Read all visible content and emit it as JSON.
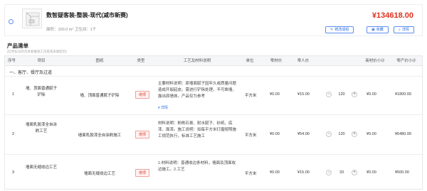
{
  "package": {
    "title": "数智疑客装-整装-现代(减市新赛)",
    "area_line": "面积：100.0 m²   卫生间：1个",
    "price": "¥134618.00",
    "buttons": {
      "edit": "修改成组",
      "collect": "收藏",
      "detail": "详情"
    }
  },
  "list": {
    "title": "产品清单",
    "subtitle": "(红色标记的为本套餐施工内容或未确定的)"
  },
  "table": {
    "headers": [
      "序号",
      "项目",
      "图纸",
      "类型",
      "工艺及材料说明",
      "单位",
      "零材价",
      "零人价",
      "",
      "商材价小计",
      "零产价小计"
    ],
    "group_label": "一、客厅、餐厅及过道",
    "detail_link": "详情",
    "rows": [
      {
        "no": "1",
        "item": "墙、顶面普通腻子铲除",
        "name": "墙、顶面普通腻子铲除",
        "type": "增项",
        "desc": "主要材料说明：原墙面腻子因年久或质量问题造成开裂起皮。需进行铲除处理，不可凿墙，露出原墙体。产品仅为参考",
        "unit": "平方米",
        "mat_price": "¥0.00",
        "labor_price": "¥15.00",
        "qty": "120",
        "subtotal_mat": "¥0.00",
        "subtotal_labor": "¥1800.00"
      },
      {
        "no": "2",
        "item": "墙面乳胶漆全自涂刷工艺",
        "name": "墙面乳胶漆全自涂刷施工",
        "type": "增项",
        "desc": "材料说明：粉刷石膏、耐水腻子、砂纸、底漆、面漆。施工说明：如每平方米打磨按照施工规范执行，标准工艺施工",
        "unit": "平方米",
        "mat_price": "¥0.00",
        "labor_price": "¥54.00",
        "qty": "120",
        "subtotal_mat": "¥0.00",
        "subtotal_labor": "¥6480.00"
      },
      {
        "no": "3",
        "item": "墙面无缝收边工艺",
        "name": "墙面无缝收边工艺",
        "type": "增项",
        "desc": "1.材料说明：普通收边条材料，墙面及顶面收边施工。2.工艺",
        "unit": "平方米",
        "mat_price": "¥0.00",
        "labor_price": "¥15.00",
        "qty": "33",
        "subtotal_mat": "¥0.00",
        "subtotal_labor": "¥500.00"
      }
    ]
  }
}
